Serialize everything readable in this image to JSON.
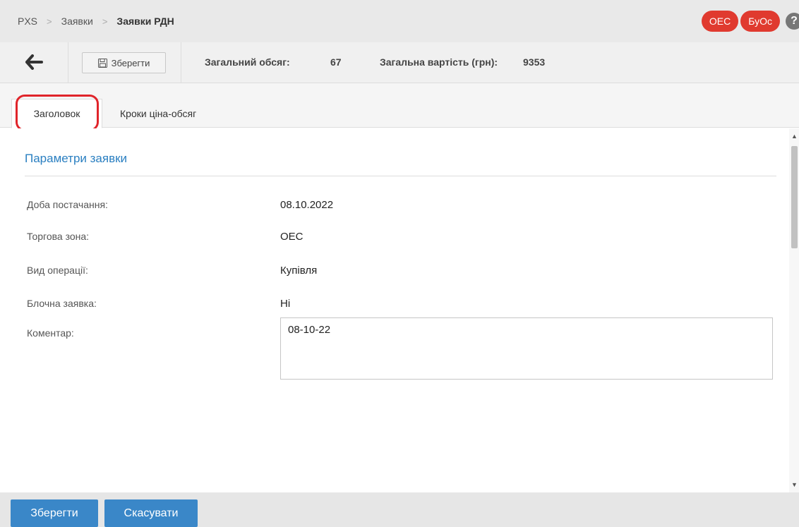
{
  "breadcrumb": [
    "PXS",
    "Заявки",
    "Заявки РДН"
  ],
  "badges": [
    "ОЕС",
    "БуОс"
  ],
  "help_icon": "question-circle-icon",
  "toolbar": {
    "save_label": "Зберегти",
    "total_volume_label": "Загальний обсяг:",
    "total_volume_value": "67",
    "total_cost_label": "Загальна вартість (грн):",
    "total_cost_value": "9353"
  },
  "tabs": [
    "Заголовок",
    "Кроки ціна-обсяг"
  ],
  "section": {
    "title": "Параметри заявки",
    "fields": [
      {
        "label": "Доба постачання:",
        "value": "08.10.2022"
      },
      {
        "label": "Торгова зона:",
        "value": "ОЕС"
      },
      {
        "label": "Вид операції:",
        "value": "Купівля"
      },
      {
        "label": "Блочна заявка:",
        "value": "Ні"
      }
    ],
    "comment_label": "Коментар:",
    "comment_value": "08-10-22"
  },
  "footer": {
    "save": "Зберегти",
    "cancel": "Скасувати"
  },
  "colors": {
    "accent": "#3a87c8",
    "badge": "#e03a2f",
    "section_title": "#2a7fc1",
    "highlight": "#e0242a"
  }
}
